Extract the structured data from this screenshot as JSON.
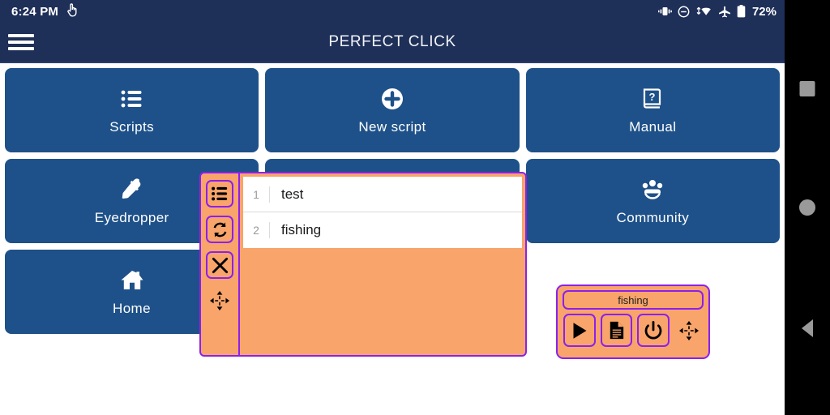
{
  "status_bar": {
    "time": "6:24 PM",
    "battery_percent": "72%",
    "icons": [
      "pointer-hand-icon",
      "vibrate-icon",
      "do-not-disturb-icon",
      "wifi-icon",
      "airplane-mode-icon",
      "battery-icon"
    ]
  },
  "title_bar": {
    "title": "PERFECT CLICK",
    "menu_icon": "hamburger-menu-icon"
  },
  "tiles": [
    {
      "label": "Scripts",
      "icon": "list-icon"
    },
    {
      "label": "New script",
      "icon": "plus-circle-icon"
    },
    {
      "label": "Manual",
      "icon": "book-question-icon"
    },
    {
      "label": "Eyedropper",
      "icon": "eyedropper-icon"
    },
    {
      "label": "Community",
      "icon": "people-group-icon"
    },
    {
      "label": "Home",
      "icon": "house-icon"
    }
  ],
  "overlay_panel": {
    "toolbar": [
      {
        "name": "list-icon",
        "label": "Script list"
      },
      {
        "name": "refresh-icon",
        "label": "Refresh"
      },
      {
        "name": "close-icon",
        "label": "Close"
      },
      {
        "name": "move-icon",
        "label": "Move"
      }
    ],
    "scripts": [
      {
        "num": "1",
        "name": "test"
      },
      {
        "num": "2",
        "name": "fishing"
      }
    ]
  },
  "runner_widget": {
    "script_name": "fishing",
    "buttons": [
      {
        "name": "play-icon",
        "label": "Run"
      },
      {
        "name": "document-icon",
        "label": "Log"
      },
      {
        "name": "power-icon",
        "label": "Stop"
      },
      {
        "name": "move-icon",
        "label": "Move"
      }
    ]
  },
  "nav_bar": {
    "recents": "recents-square-icon",
    "home": "home-circle-icon",
    "back": "back-triangle-icon"
  },
  "colors": {
    "header": "#1e2f58",
    "tile": "#1e5189",
    "overlay_bg": "#f8a46a",
    "overlay_border": "#8b20ef",
    "navbar": "#000000"
  }
}
